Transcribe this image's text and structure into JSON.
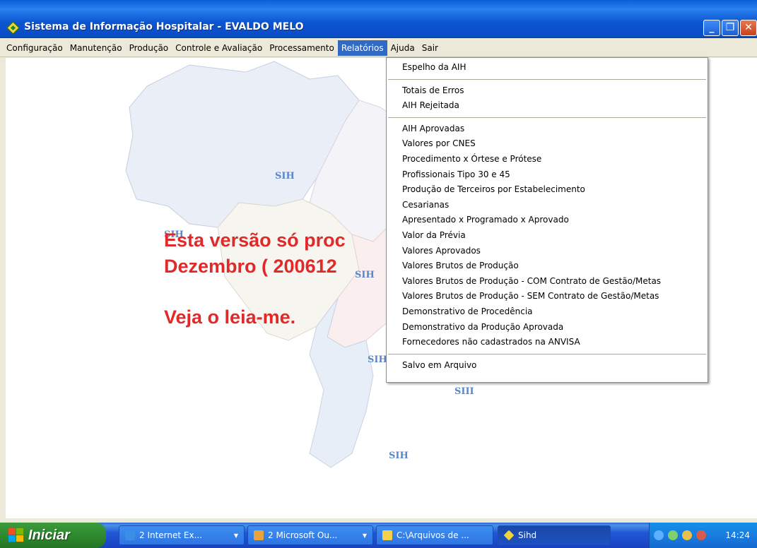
{
  "window": {
    "title": "Sistema de Informação Hospitalar - EVALDO MELO"
  },
  "menubar": {
    "items": [
      {
        "label": "Configuração"
      },
      {
        "label": "Manutenção"
      },
      {
        "label": "Produção"
      },
      {
        "label": "Controle e Avaliação"
      },
      {
        "label": "Processamento"
      },
      {
        "label": "Relatórios"
      },
      {
        "label": "Ajuda"
      },
      {
        "label": "Sair"
      }
    ],
    "active": "Relatórios"
  },
  "relatorios_menu": {
    "groups": [
      [
        "Espelho da AIH"
      ],
      [
        "Totais de Erros",
        "AIH Rejeitada"
      ],
      [
        "AIH Aprovadas",
        "Valores por CNES",
        "Procedimento x Órtese e Prótese",
        "Profissionais Tipo 30 e 45",
        "Produção de Terceiros por Estabelecimento",
        "Cesarianas",
        "Apresentado x Programado x Aprovado",
        "Valor da Prévia",
        "Valores Aprovados",
        "Valores Brutos de Produção",
        "Valores Brutos de Produção - COM Contrato de Gestão/Metas",
        "Valores Brutos de Produção - SEM Contrato de Gestão/Metas",
        "Demonstrativo de Procedência",
        "Demonstrativo da Produção Aprovada",
        "Fornecedores não cadastrados na ANVISA"
      ],
      [
        "Salvo em Arquivo"
      ]
    ]
  },
  "background": {
    "map_labels": [
      "SIH",
      "SIH",
      "SIH",
      "SIH",
      "SIII",
      "SIH"
    ],
    "message_line1": "Esta versão só proc",
    "message_line2": "Dezembro ( 200612",
    "message_line3": "Veja o leia-me."
  },
  "taskbar": {
    "start_label": "Iniciar",
    "tasks": [
      {
        "label": "2 Internet Ex...",
        "icon_color": "#3a8ee8"
      },
      {
        "label": "2 Microsoft Ou...",
        "icon_color": "#e8a33a"
      },
      {
        "label": "C:\\Arquivos de ...",
        "icon_color": "#f3d14a"
      },
      {
        "label": "Sihd",
        "icon_color": "#f3d33a"
      }
    ],
    "clock": "14:24"
  }
}
